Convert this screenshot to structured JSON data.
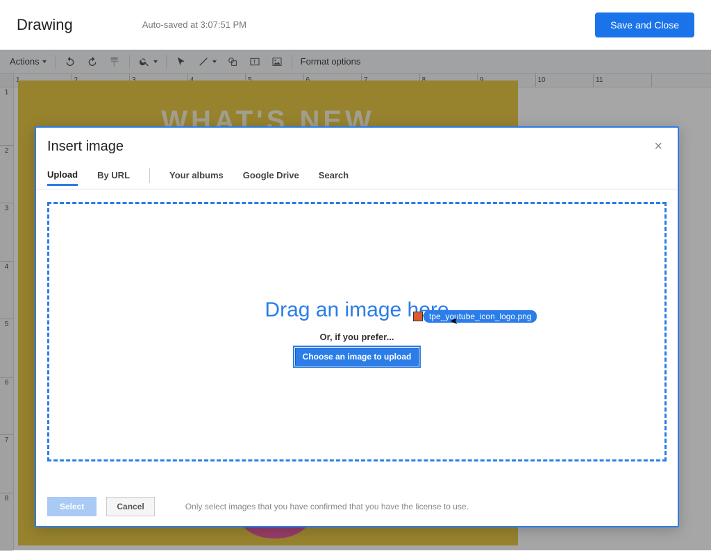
{
  "header": {
    "title": "Drawing",
    "autosave": "Auto-saved at 3:07:51 PM",
    "save_close": "Save and Close"
  },
  "toolbar": {
    "actions": "Actions",
    "format_options": "Format options"
  },
  "ruler": {
    "h": [
      "1",
      "2",
      "3",
      "4",
      "5",
      "6",
      "7",
      "8",
      "9",
      "10",
      "11"
    ],
    "v": [
      "1",
      "2",
      "3",
      "4",
      "5",
      "6",
      "7",
      "8"
    ]
  },
  "canvas": {
    "headline": "WHAT'S NEW"
  },
  "modal": {
    "title": "Insert image",
    "tabs": {
      "upload": "Upload",
      "by_url": "By URL",
      "your_albums": "Your albums",
      "google_drive": "Google Drive",
      "search": "Search"
    },
    "dropzone": {
      "drag_text": "Drag an image here",
      "or_text": "Or, if you prefer...",
      "choose_button": "Choose an image to upload"
    },
    "drag_file_name": "tpe_youtube_icon_logo.png",
    "footer": {
      "select": "Select",
      "cancel": "Cancel",
      "license_note": "Only select images that you have confirmed that you have the license to use."
    }
  }
}
